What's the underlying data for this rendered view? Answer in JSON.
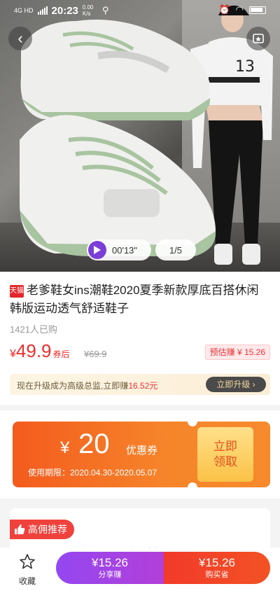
{
  "status_bar": {
    "network": "4G HD",
    "time": "20:23",
    "speed": "0.00 K/s"
  },
  "hero": {
    "video_duration": "00'13\"",
    "image_counter": "1/5"
  },
  "product": {
    "store_badge": "天猫",
    "title": "老爹鞋女ins潮鞋2020夏季新款厚底百搭休闲韩版运动透气舒适鞋子",
    "sold": "1421人已购",
    "price_currency": "¥",
    "price": "49.9",
    "price_suffix": "券后",
    "original_price": "¥69.9",
    "estimated_earn": "预估赚 ¥ 15.26"
  },
  "upgrade": {
    "text_prefix": "现在升级成为高级总监,立即赚",
    "text_amount": "16.52元",
    "button": "立即升级"
  },
  "coupon": {
    "currency": "¥",
    "amount": "20",
    "label": "优惠券",
    "valid": "使用期限：2020.04.30-2020.05.07",
    "claim_line1": "立即",
    "claim_line2": "领取"
  },
  "recommend": {
    "tag": "高佣推荐",
    "line": "商品：ins网红韩版春夏厚底老爹女鞋"
  },
  "bottom_bar": {
    "collect": "收藏",
    "share_amount": "¥15.26",
    "share_label": "分享赚",
    "buy_amount": "¥15.26",
    "buy_label": "购买省"
  },
  "colors": {
    "price_red": "#f02c2c",
    "coupon_orange": "#f35b1e",
    "share_purple": "#9447f0",
    "buy_red": "#f23a2a"
  }
}
